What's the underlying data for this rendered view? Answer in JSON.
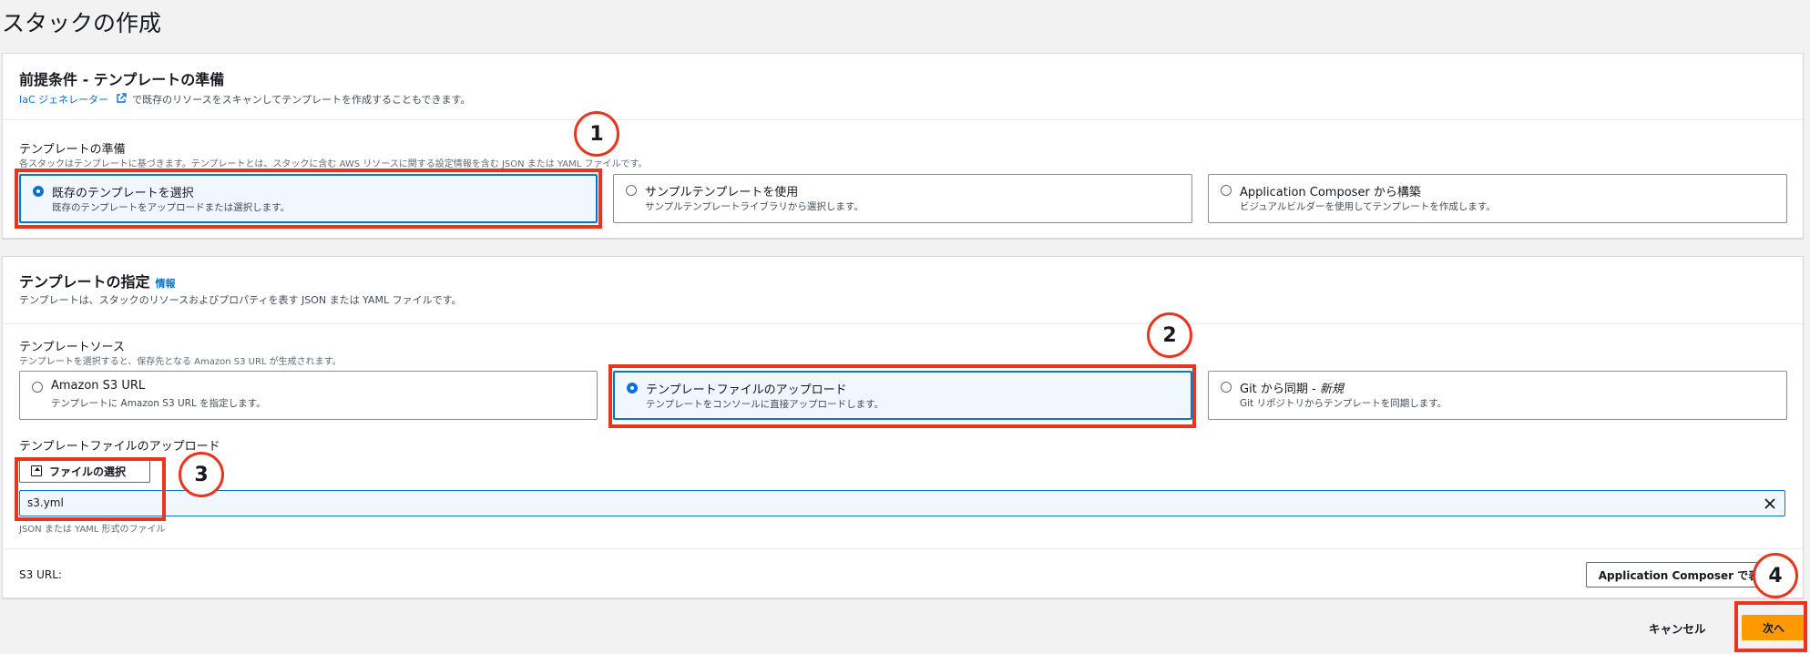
{
  "page_title": "スタックの作成",
  "prereq": {
    "heading": "前提条件 - テンプレートの準備",
    "generator_link": "IaC ジェネレーター",
    "generator_desc": "で既存のリソースをスキャンしてテンプレートを作成することもできます。",
    "prepare_label": "テンプレートの準備",
    "prepare_desc": "各スタックはテンプレートに基づきます。テンプレートとは、スタックに含む AWS リソースに関する設定情報を含む JSON または YAML ファイルです。",
    "options": [
      {
        "label": "既存のテンプレートを選択",
        "desc": "既存のテンプレートをアップロードまたは選択します。",
        "selected": true
      },
      {
        "label": "サンプルテンプレートを使用",
        "desc": "サンプルテンプレートライブラリから選択します。",
        "selected": false
      },
      {
        "label": "Application Composer から構築",
        "desc": "ビジュアルビルダーを使用してテンプレートを作成します。",
        "selected": false
      }
    ]
  },
  "spec": {
    "heading": "テンプレートの指定",
    "info": "情報",
    "desc": "テンプレートは、スタックのリソースおよびプロパティを表す JSON または YAML ファイルです。",
    "source_label": "テンプレートソース",
    "source_desc": "テンプレートを選択すると、保存先となる Amazon S3 URL が生成されます。",
    "options": [
      {
        "label": "Amazon S3 URL",
        "desc": "テンプレートに Amazon S3 URL を指定します。",
        "selected": false
      },
      {
        "label": "テンプレートファイルのアップロード",
        "desc": "テンプレートをコンソールに直接アップロードします。",
        "selected": true
      },
      {
        "label": "Git から同期 - ",
        "label_em": "新規",
        "desc": "Git リポジトリからテンプレートを同期します。",
        "selected": false
      }
    ],
    "upload_label": "テンプレートファイルのアップロード",
    "choose_file": "ファイルの選択",
    "file_name": "s3.yml",
    "file_hint": "JSON または YAML 形式のファイル",
    "s3_url_label": "S3 URL:",
    "composer_button": "Application Composer で表示"
  },
  "footer": {
    "cancel": "キャンセル",
    "next": "次へ"
  },
  "annotations": [
    "1",
    "2",
    "3",
    "4"
  ],
  "colors": {
    "accent": "#0972d3",
    "primary_button": "#ff9900",
    "annotation": "#e8351f"
  }
}
